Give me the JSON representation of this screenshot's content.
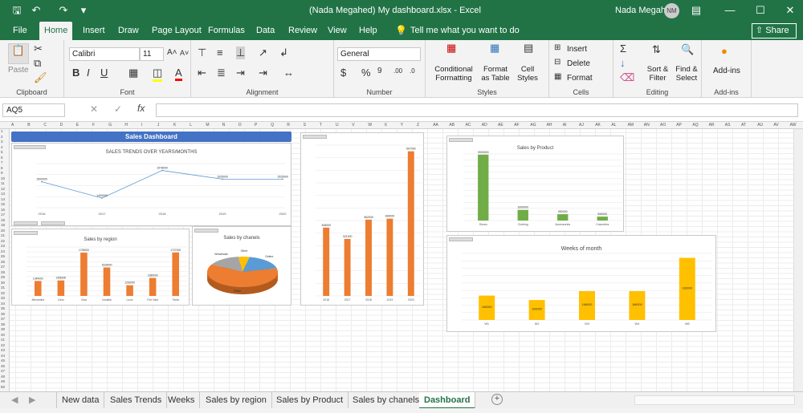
{
  "window": {
    "title": "(Nada Megahed) My dashboard.xlsx  -  Excel",
    "user": "Nada Megahed",
    "initials": "NM"
  },
  "menu_tabs": [
    "File",
    "Home",
    "Insert",
    "Draw",
    "Page Layout",
    "Formulas",
    "Data",
    "Review",
    "View",
    "Help"
  ],
  "tell_me": "Tell me what you want to do",
  "share": "Share",
  "ribbon": {
    "paste": "Paste",
    "clipboard": "Clipboard",
    "font_name": "Calibri",
    "font_size": "11",
    "font": "Font",
    "alignment": "Alignment",
    "number_format": "General",
    "number": "Number",
    "conditional_formatting": "Conditional Formatting",
    "format_as_table": "Format as Table",
    "cell_styles": "Cell Styles",
    "styles": "Styles",
    "insert": "Insert",
    "delete": "Delete",
    "format": "Format",
    "cells": "Cells",
    "sort_filter": "Sort & Filter",
    "find_select": "Find & Select",
    "editing": "Editing",
    "add_ins": "Add-ins",
    "add_ins_group": "Add-ins"
  },
  "formula_bar": {
    "name_box": "AQ5",
    "fx": "fx",
    "value": ""
  },
  "columns": [
    "A",
    "B",
    "C",
    "D",
    "E",
    "F",
    "G",
    "H",
    "I",
    "J",
    "K",
    "L",
    "M",
    "N",
    "O",
    "P",
    "Q",
    "R",
    "S",
    "T",
    "U",
    "V",
    "W",
    "X",
    "Y",
    "Z",
    "AA",
    "AB",
    "AC",
    "AD",
    "AE",
    "AF",
    "AG",
    "AH",
    "AI",
    "AJ",
    "AK",
    "AL",
    "AM",
    "AN",
    "AO",
    "AP",
    "AQ",
    "AR",
    "AS",
    "AT",
    "AU",
    "AV",
    "AW"
  ],
  "dashboard_title": "Sales Dashboard",
  "charts": {
    "trends_title": "SALES TRENDS OVER YEARS/MONTHS",
    "region_title": "Sales by region",
    "channels_title": "Sales by chanels",
    "product_title": "Sales by Product",
    "weeks_title": "Weeks of month"
  },
  "sheet_tabs": [
    "New data",
    "Sales Trends",
    "Weeks",
    "Sales by region",
    "Sales by Product",
    "Sales by chanels",
    "Dashboard"
  ],
  "active_sheet": "Dashboard",
  "colors": {
    "excel_green": "#217346",
    "orange": "#ed7d31",
    "green": "#70ad47",
    "gold": "#ffc000",
    "blue": "#5b9bd5",
    "title_blue": "#4472c4"
  },
  "chart_data": [
    {
      "type": "line",
      "title": "SALES TRENDS OVER YEARS/MONTHS",
      "categories": [
        "2016",
        "2017",
        "2018",
        "2019",
        "2020"
      ],
      "values": [
        1509000,
        1409000,
        1578000,
        1525000,
        1525000
      ]
    },
    {
      "type": "bar",
      "title": "Sales by region",
      "categories": [
        "Alexandria",
        "Cairo",
        "Giza",
        "Ismailia",
        "Luxor",
        "Port Said",
        "Tanta"
      ],
      "values": [
        1349000,
        1356000,
        1725000,
        1528000,
        1292000,
        1389000,
        1727000
      ]
    },
    {
      "type": "pie",
      "title": "Sales by chanels",
      "categories": [
        "Online",
        "Retail",
        "Wholesale",
        "Other"
      ],
      "values": [
        18,
        62,
        15,
        5
      ]
    },
    {
      "type": "bar",
      "title": "",
      "categories": [
        "2016",
        "2017",
        "2018",
        "2019",
        "2020"
      ],
      "values": [
        345000,
        321000,
        362000,
        364000,
        507000
      ]
    },
    {
      "type": "bar",
      "title": "Sales by Product",
      "categories": [
        "Shoes",
        "Clothing",
        "Accessories",
        "Cosmetics"
      ],
      "values": [
        9900000,
        1600000,
        950000,
        590000
      ]
    },
    {
      "type": "bar",
      "title": "Weeks of month",
      "categories": [
        "W1",
        "W2",
        "W3",
        "W4",
        "W5"
      ],
      "values": [
        166000,
        164000,
        168000,
        168000,
        183000
      ]
    }
  ]
}
